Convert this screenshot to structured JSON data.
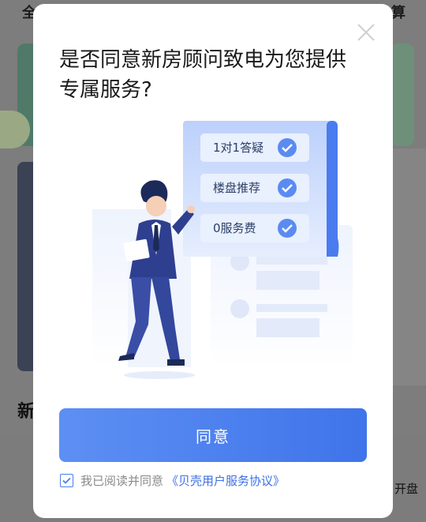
{
  "background": {
    "top_left_text": "全",
    "top_right_text": "算",
    "section_text": "新",
    "side_text": "开盘"
  },
  "dialog": {
    "title": "是否同意新房顾问致电为您提供专属服务?",
    "benefits": [
      "1对1答疑",
      "楼盘推荐",
      "0服务费"
    ],
    "agree_button": "同意",
    "agreement_prefix": "我已阅读并同意",
    "agreement_link": "《贝壳用户服务协议》",
    "checkbox_checked": true,
    "accent_color": "#4a7cf0"
  },
  "icons": {
    "close": "close-icon",
    "check": "check-icon",
    "checkbox": "checkbox-icon"
  }
}
